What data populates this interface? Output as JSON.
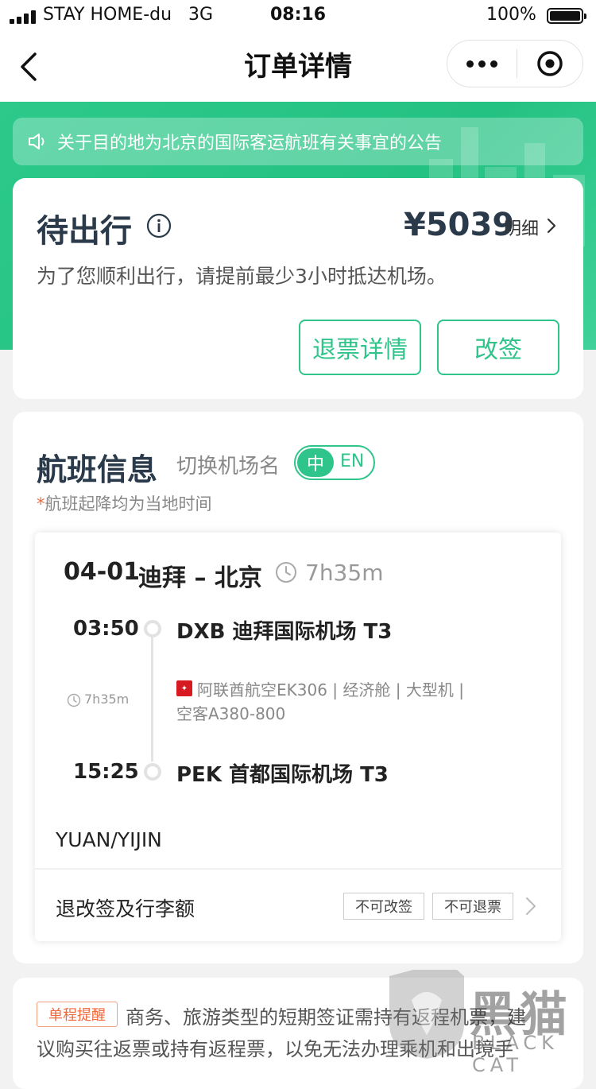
{
  "status_bar": {
    "carrier": "STAY HOME-du",
    "network": "3G",
    "time": "08:16",
    "battery": "100%",
    "battery_level": 1.0
  },
  "nav": {
    "title": "订单详情",
    "back_icon": "chevron-left-icon",
    "more_icon": "more-dots-icon",
    "close_icon": "target-close-icon"
  },
  "notice": {
    "icon": "speaker-icon",
    "text": "关于目的地为北京的国际客运航班有关事宜的公告"
  },
  "order_status": {
    "title": "待出行",
    "price": "¥5039",
    "detail_label": "明细",
    "subtitle": "为了您顺利出行，请提前最少3小时抵达机场。",
    "refund_button": "退票详情",
    "change_button": "改签"
  },
  "flight_info": {
    "title": "航班信息",
    "switch_label": "切换机场名",
    "toggle_zh": "中",
    "toggle_en": "EN",
    "toggle_selected": "中",
    "note_star": "*",
    "note": "航班起降均为当地时间",
    "route_date": "04-01",
    "route_cities": "迪拜 – 北京",
    "total_duration": "7h35m",
    "departure_time": "03:50",
    "departure_airport": "DXB 迪拜国际机场 T3",
    "segment_duration": "7h35m",
    "airline_line1": "阿联酋航空EK306 | 经济舱 | 大型机 |",
    "airline_line2": "空客A380-800",
    "arrival_time": "15:25",
    "arrival_airport": "PEK 首都国际机场 T3",
    "passenger": "YUAN/YIJIN",
    "baggage_label": "退改签及行李额",
    "tag_no_change": "不可改签",
    "tag_no_refund": "不可退票"
  },
  "reminder": {
    "tag": "单程提醒",
    "text_line1": "商务、旅游类型的短期签证需持有返程机票，建",
    "text_line2": "议购买往返票或持有返程票，以免无法办理乘机和出境手"
  },
  "watermark": {
    "text": "黑猫",
    "sub": "BLACK CAT"
  },
  "colors": {
    "brand_green": "#2ec48a",
    "header_green": "#24c282",
    "reminder_orange": "#f06a40"
  }
}
